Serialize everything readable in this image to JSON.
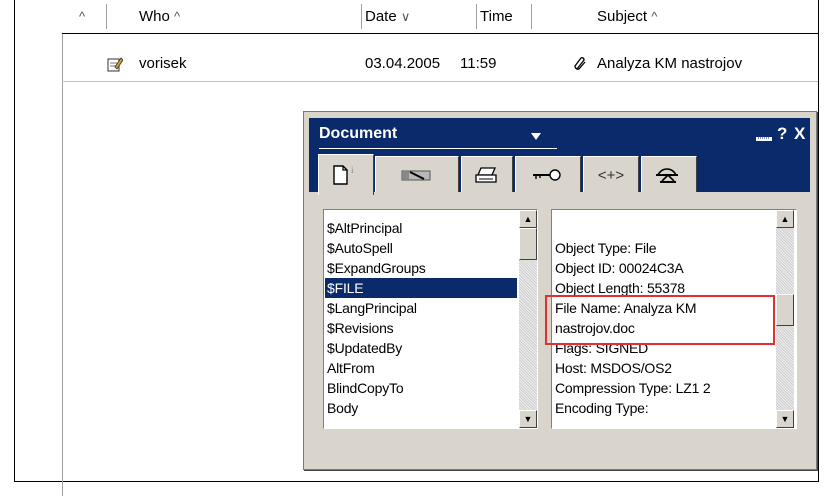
{
  "header": {
    "sort_icon": "^",
    "who": "Who",
    "who_arrow": "^",
    "date": "Date",
    "date_arrow": "∨",
    "time": "Time",
    "subject": "Subject",
    "subject_arrow": "^"
  },
  "row": {
    "icon": "edit-note-icon",
    "who": "vorisek",
    "date": "03.04.2005",
    "time": "11:59",
    "attachment_icon": "paperclip-icon",
    "subject": "Analyza KM nastrojov"
  },
  "dialog": {
    "title": "Document",
    "help": "?",
    "close": "X",
    "tabs": [
      {
        "icon": "document-info-icon",
        "glyph": "🗋"
      },
      {
        "icon": "fields-icon",
        "glyph": "▤"
      },
      {
        "icon": "printer-icon",
        "glyph": "⎙"
      },
      {
        "icon": "key-icon",
        "glyph": "⚿"
      },
      {
        "icon": "html-tags-icon",
        "glyph": "<+>"
      },
      {
        "icon": "hats-icon",
        "glyph": "⛑"
      }
    ],
    "fields": [
      "$AltPrincipal",
      "$AutoSpell",
      "$ExpandGroups",
      "$FILE",
      "$LangPrincipal",
      "$Revisions",
      "$UpdatedBy",
      "AltFrom",
      "BlindCopyTo",
      "Body"
    ],
    "selected_field": "$FILE",
    "values": [
      "",
      "Object Type: File",
      "Object ID: 00024C3A",
      "Object Length: 55378",
      "File Name: Analyza KM",
      "nastrojov.doc",
      "Flags: SIGNED",
      "Host: MSDOS/OS2",
      "Compression Type: LZ1 2",
      "Encoding Type:"
    ]
  },
  "colors": {
    "titlebar": "#0a2a6b",
    "selection": "#0a2a6b",
    "highlight": "#e03030",
    "dialog_bg": "#d9d5cc"
  }
}
